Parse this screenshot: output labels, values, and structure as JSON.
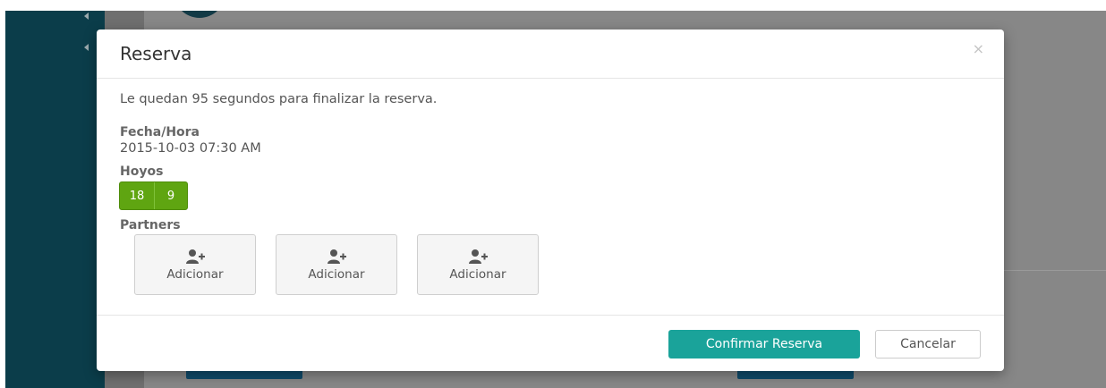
{
  "modal": {
    "title": "Reserva",
    "close_glyph": "×",
    "countdown_text": "Le quedan 95 segundos para finalizar la reserva.",
    "date_label": "Fecha/Hora",
    "date_value": "2015-10-03 07:30 AM",
    "holes_label": "Hoyos",
    "holes_options": [
      "18",
      "9"
    ],
    "partners_label": "Partners",
    "partners": [
      {
        "label": "Adicionar",
        "icon": "add-user-icon"
      },
      {
        "label": "Adicionar",
        "icon": "add-user-icon"
      },
      {
        "label": "Adicionar",
        "icon": "add-user-icon"
      }
    ],
    "confirm_label": "Confirmar Reserva",
    "cancel_label": "Cancelar"
  },
  "colors": {
    "accent": "#1aa39a",
    "holes_green": "#5fa511",
    "sidebar": "#0b3d4a",
    "backdrop": "#878787"
  }
}
